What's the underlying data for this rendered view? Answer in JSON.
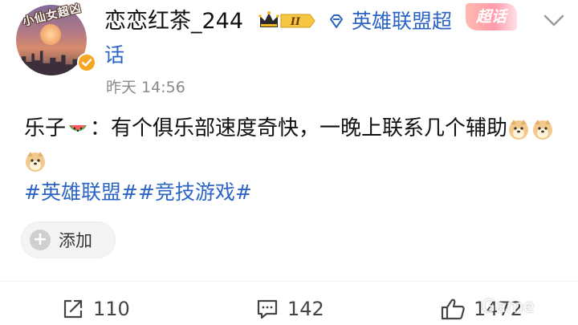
{
  "post": {
    "avatar_sticker_text": "小仙女超凶",
    "username": "恋恋红茶_244",
    "vip_level": "II",
    "topic_line1": "英雄联盟超",
    "topic_line2": "话",
    "supertopic_tag": "超话",
    "timestamp": "昨天 14:56",
    "text_part1": "乐子",
    "text_part2": "：有个俱乐部速度奇快，一晚上联系几个辅助",
    "hashtags": [
      "#英雄联盟#",
      "#竞技游戏#"
    ],
    "add_button_label": "添加"
  },
  "actions": {
    "repost_count": "110",
    "comment_count": "142",
    "like_count": "1472"
  },
  "watermark": "Game",
  "colors": {
    "link_blue": "#2b64c4",
    "text": "#111111",
    "muted": "#8a8a8a",
    "verify_orange": "#f5a623"
  },
  "icons": {
    "repost": "repost-icon",
    "comment": "comment-icon",
    "like": "thumbs-up-icon",
    "verify": "verified-badge-icon",
    "crown": "vip-crown-icon",
    "topic": "diamond-topic-icon",
    "chevron": "chevron-down-icon",
    "watermelon": "watermelon-emoji",
    "doge": "doge-emoji"
  }
}
